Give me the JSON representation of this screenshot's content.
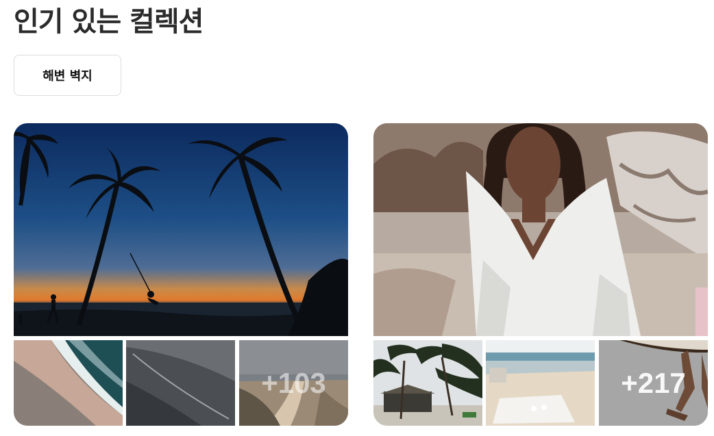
{
  "page": {
    "title": "인기 있는 컬렉션"
  },
  "filter_chip": {
    "label": "해변 벽지"
  },
  "collections": [
    {
      "more_count_label": "+103",
      "hero_icon": "palm-sunset-image",
      "thumb_icons": [
        "aerial-shore-image",
        "dark-sand-image",
        "beach-path-image"
      ]
    },
    {
      "more_count_label": "+217",
      "hero_icon": "portrait-beach-image",
      "thumb_icons": [
        "palm-house-image",
        "beach-picnic-image",
        "surfer-legs-image"
      ]
    }
  ]
}
